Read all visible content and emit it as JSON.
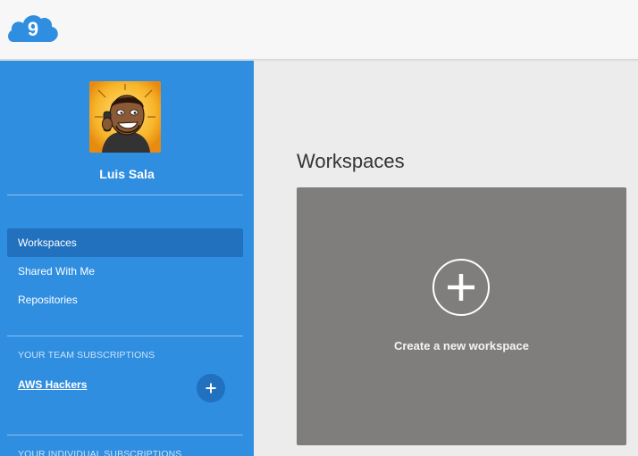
{
  "header": {
    "logo_text": "9",
    "logo_icon": "cloud9-logo-icon"
  },
  "sidebar": {
    "user": {
      "name": "Luis Sala",
      "avatar_icon": "caricature-avatar"
    },
    "nav": [
      {
        "label": "Workspaces",
        "active": true
      },
      {
        "label": "Shared With Me",
        "active": false
      },
      {
        "label": "Repositories",
        "active": false
      }
    ],
    "team_subscriptions": {
      "heading": "YOUR TEAM SUBSCRIPTIONS",
      "teams": [
        "AWS Hackers"
      ],
      "add_icon": "plus-icon"
    },
    "individual_subscriptions": {
      "heading": "YOUR INDIVIDUAL SUBSCRIPTIONS"
    }
  },
  "main": {
    "title": "Workspaces",
    "create_card": {
      "label": "Create a new workspace",
      "icon": "plus-circle-icon"
    }
  },
  "colors": {
    "sidebar": "#2f8ee0",
    "sidebar_active": "#2171bf",
    "card": "#7f7e7c",
    "background": "#ececec",
    "logo": "#2f8ee0"
  }
}
